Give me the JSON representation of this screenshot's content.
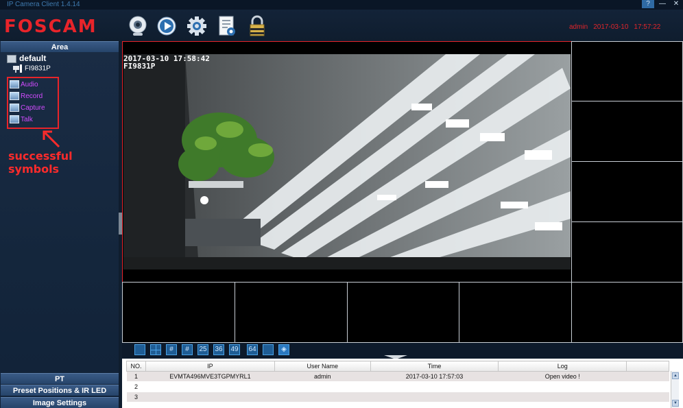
{
  "window": {
    "title": "IP Camera Client 1.4.14",
    "help_label": "?",
    "minimize_label": "—",
    "close_label": "✕"
  },
  "header": {
    "logo": "FOSCAM",
    "toolbar_icons": [
      "webcam-icon",
      "play-icon",
      "gear-icon",
      "log-document-icon",
      "lock-icon"
    ],
    "status": {
      "user": "admin",
      "date": "2017-03-10",
      "time": "17:57:22"
    }
  },
  "left_panel": {
    "area_title": "Area",
    "tree": {
      "group": "default",
      "camera": "FI9831P",
      "symbols": [
        "Audio",
        "Record",
        "Capture",
        "Talk"
      ]
    },
    "annotation": "successful symbols",
    "bottom_sections": [
      "PT",
      "Preset Positions & IR LED",
      "Image Settings"
    ]
  },
  "video": {
    "osd_datetime": "2017-03-10 17:58:42",
    "osd_camera": "FI9831P"
  },
  "layout_toolbar": [
    "",
    "",
    "",
    "",
    "25",
    "36",
    "49",
    "64",
    "",
    ""
  ],
  "log": {
    "columns": [
      "NO.",
      "IP",
      "User Name",
      "Time",
      "Log",
      ""
    ],
    "rows": [
      {
        "no": "1",
        "ip": "EVMTA496MVE3TGPMYRL1",
        "user": "admin",
        "time": "2017-03-10 17:57:03",
        "log": "Open video !"
      },
      {
        "no": "2",
        "ip": "",
        "user": "",
        "time": "",
        "log": ""
      },
      {
        "no": "3",
        "ip": "",
        "user": "",
        "time": "",
        "log": ""
      }
    ]
  },
  "colors": {
    "brand_red": "#e8242a",
    "symbol_purple": "#d24bff",
    "panel_blue": "#26446a",
    "layout_button": "#1f5d95"
  }
}
